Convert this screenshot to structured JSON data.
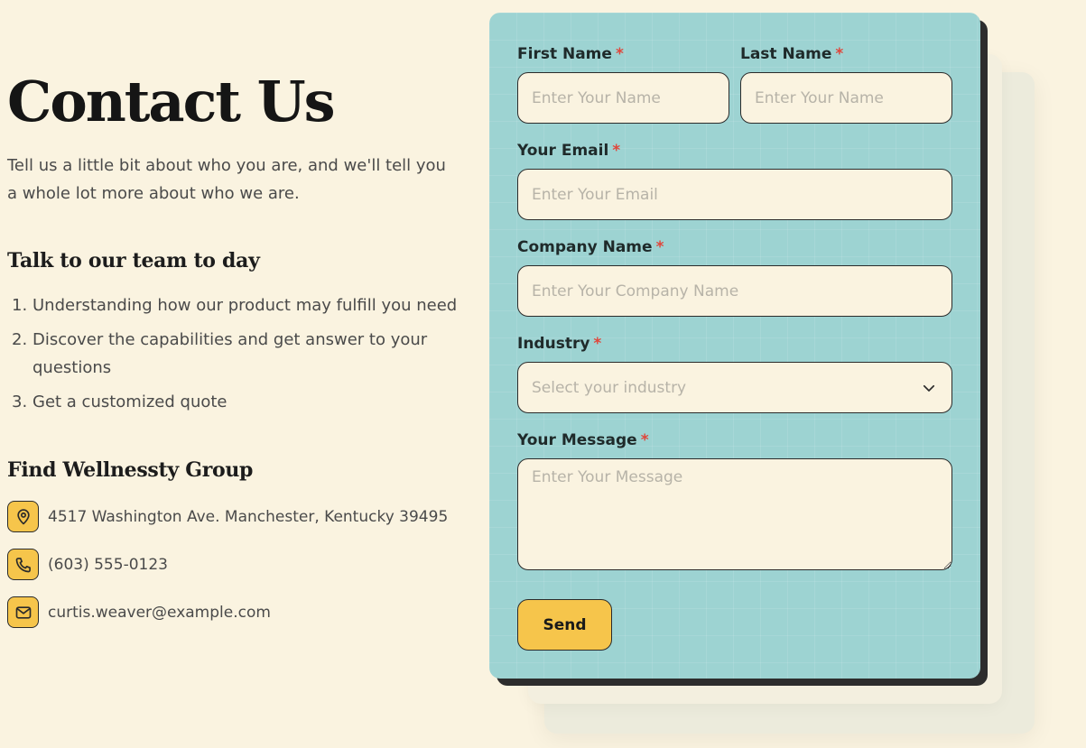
{
  "info": {
    "title": "Contact Us",
    "intro": "Tell us a little bit about who you are, and we'll tell you a whole lot more about who we are.",
    "talk_heading": "Talk to our team to day",
    "steps": [
      {
        "num": "1.",
        "text": "Understanding how our product may fulfill you need"
      },
      {
        "num": "2.",
        "text": "Discover the capabilities and get answer to your questions"
      },
      {
        "num": "3.",
        "text": "Get a customized quote"
      }
    ],
    "find_heading": "Find Wellnessty Group",
    "address": "4517 Washington Ave. Manchester, Kentucky 39495",
    "phone": "(603) 555-0123",
    "email": "curtis.weaver@example.com",
    "icons": {
      "address": "map-pin-icon",
      "phone": "phone-icon",
      "email": "mail-icon"
    }
  },
  "form": {
    "required_mark": "*",
    "first_name": {
      "label": "First Name",
      "placeholder": "Enter Your Name",
      "value": ""
    },
    "last_name": {
      "label": "Last Name",
      "placeholder": "Enter Your Name",
      "value": ""
    },
    "email": {
      "label": "Your Email",
      "placeholder": "Enter Your Email",
      "value": ""
    },
    "company": {
      "label": "Company Name",
      "placeholder": "Enter Your Company Name",
      "value": ""
    },
    "industry": {
      "label": "Industry",
      "placeholder": "Select your industry",
      "value": ""
    },
    "message": {
      "label": "Your Message",
      "placeholder": "Enter Your Message",
      "value": ""
    },
    "send_label": "Send"
  },
  "colors": {
    "background": "#faf3e0",
    "card": "#9dd3d2",
    "accent": "#f6c54b",
    "required": "#e0463b",
    "border": "#2b2b2b"
  }
}
